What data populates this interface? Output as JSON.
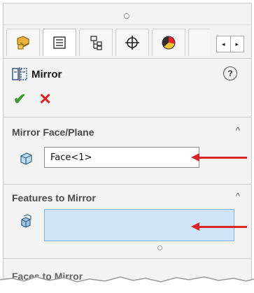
{
  "tabs": [
    {
      "icon": "feature-manager-icon",
      "active": false
    },
    {
      "icon": "property-manager-icon",
      "active": true
    },
    {
      "icon": "configuration-manager-icon",
      "active": false
    },
    {
      "icon": "dimxpert-icon",
      "active": false
    },
    {
      "icon": "display-manager-icon",
      "active": false
    }
  ],
  "scroll": {
    "left": "◂",
    "right": "▸"
  },
  "panel": {
    "title": "Mirror",
    "help": "?",
    "ok": "✔",
    "cancel": "✕"
  },
  "mirror_face": {
    "label": "Mirror Face/Plane",
    "value": "Face<1>"
  },
  "features": {
    "label": "Features to Mirror",
    "value": ""
  },
  "faces": {
    "label": "Faces to Mirror"
  },
  "colors": {
    "accent_red": "#d9262a",
    "selection_blue": "#cfe4f7",
    "ok_green": "#3a9a2e"
  }
}
